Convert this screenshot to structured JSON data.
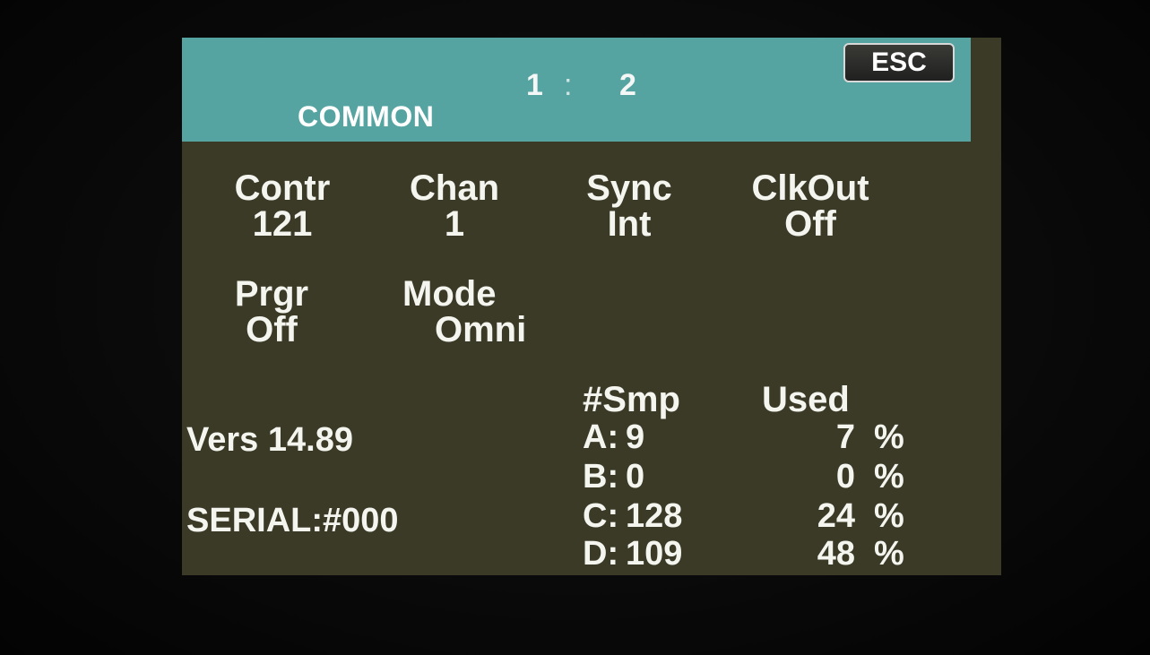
{
  "header": {
    "page_current": "1",
    "separator": ":",
    "page_total": "2",
    "title": "COMMON",
    "esc_label": "ESC"
  },
  "params": {
    "contr": {
      "label": "Contr",
      "value": "121"
    },
    "chan": {
      "label": "Chan",
      "value": "1"
    },
    "sync": {
      "label": "Sync",
      "value": "Int"
    },
    "clkout": {
      "label": "ClkOut",
      "value": "Off"
    },
    "prgr": {
      "label": "Prgr",
      "value": "Off"
    },
    "mode": {
      "label": "Mode",
      "value": "Omni"
    }
  },
  "info": {
    "version": "Vers 14.89",
    "serial": "SERIAL:#000"
  },
  "memory": {
    "samples_header": "#Smp",
    "used_header": "Used",
    "percent_sign": "%",
    "banks": [
      {
        "bank": "A:",
        "samples": "9",
        "used": "7"
      },
      {
        "bank": "B:",
        "samples": "0",
        "used": "0"
      },
      {
        "bank": "C:",
        "samples": "128",
        "used": "24"
      },
      {
        "bank": "D:",
        "samples": "109",
        "used": "48"
      }
    ]
  },
  "colors": {
    "header_bg": "#55a4a2",
    "screen_bg": "#3b3a27",
    "text": "#f5f5f0"
  }
}
